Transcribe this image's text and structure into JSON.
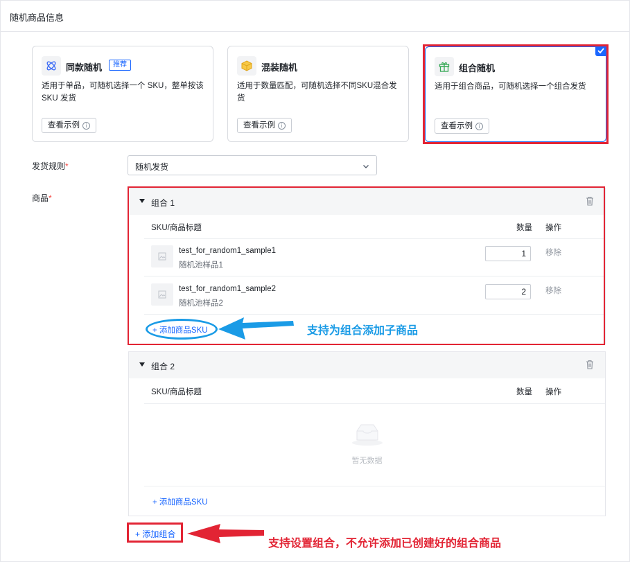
{
  "section": {
    "title": "随机商品信息"
  },
  "cards": [
    {
      "title": "同款随机",
      "badge": "推荐",
      "desc": "适用于单品，可随机选择一个 SKU，整单按该 SKU 发货",
      "example_label": "查看示例",
      "icon": "atom-icon",
      "selected": false
    },
    {
      "title": "混装随机",
      "badge": "",
      "desc": "适用于数量匹配，可随机选择不同SKU混合发货",
      "example_label": "查看示例",
      "icon": "box-icon",
      "selected": false
    },
    {
      "title": "组合随机",
      "badge": "",
      "desc": "适用于组合商品，可随机选择一个组合发货",
      "example_label": "查看示例",
      "icon": "gift-icon",
      "selected": true
    }
  ],
  "form": {
    "ship_rule_label": "发货规则",
    "ship_rule_value": "随机发货",
    "goods_label": "商品",
    "required_mark": "*"
  },
  "groups": [
    {
      "name": "组合 1",
      "columns": {
        "sku": "SKU/商品标题",
        "qty": "数量",
        "action": "操作"
      },
      "items": [
        {
          "title": "test_for_random1_sample1",
          "subtitle": "随机池样品1",
          "qty": "1",
          "action": "移除"
        },
        {
          "title": "test_for_random1_sample2",
          "subtitle": "随机池样品2",
          "qty": "2",
          "action": "移除"
        }
      ],
      "add_sku_label": "+ 添加商品SKU"
    },
    {
      "name": "组合 2",
      "columns": {
        "sku": "SKU/商品标题",
        "qty": "数量",
        "action": "操作"
      },
      "items": [],
      "empty_text": "暂无数据",
      "add_sku_label": "+ 添加商品SKU"
    }
  ],
  "add_group_label": "+ 添加组合",
  "annotations": {
    "add_sku_note": "支持为组合添加子商品",
    "add_group_note": "支持设置组合，不允许添加已创建好的组合商品"
  },
  "colors": {
    "accent": "#1966ff",
    "highlight_red": "#e22434",
    "annotation_blue": "#1a9be6",
    "required": "#f54a45"
  }
}
